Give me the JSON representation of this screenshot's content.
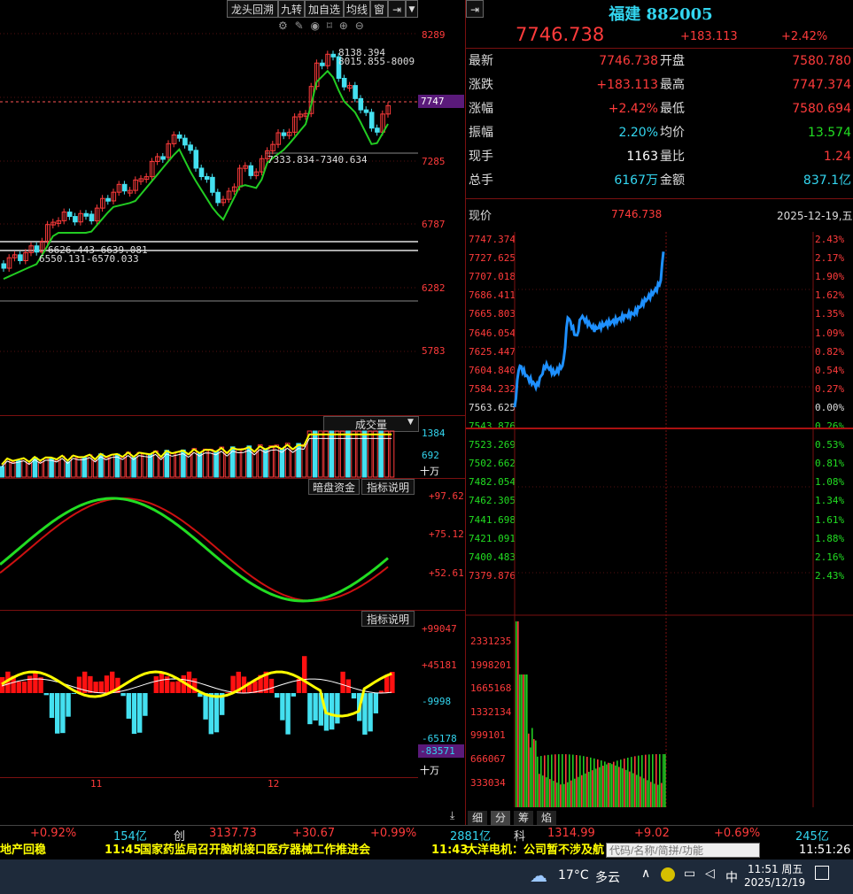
{
  "toolbar": {
    "buttons": [
      "龙头回溯",
      "九转",
      "加自选",
      "均线",
      "窗"
    ],
    "icon_names": [
      "settings-icon",
      "brush-icon",
      "eye-icon",
      "bookmark-icon",
      "zoom-in-icon",
      "zoom-out-icon"
    ]
  },
  "kline": {
    "price_axis": [
      "8289",
      "7747",
      "7285",
      "6787",
      "6282",
      "5783"
    ],
    "annotations": {
      "high": "8138.394",
      "high_range": "8015.855-8009",
      "mid_range": "7333.834-7340.634",
      "low_range_1": "6626.443-6639.081",
      "low_range_2": "6550.131-6570.033"
    },
    "current_price_tag": "7747"
  },
  "volume": {
    "panel_title": "成交量",
    "axis": [
      "1384",
      "692",
      "十万"
    ]
  },
  "kdj": {
    "buttons": [
      "暗盘资金",
      "指标说明"
    ],
    "axis": [
      "+97.62",
      "+75.12",
      "+52.61"
    ]
  },
  "macd": {
    "button": "指标说明",
    "axis": [
      "+99047",
      "+45181",
      "-9998",
      "-65178",
      "-83571",
      "十万"
    ],
    "months": [
      "11",
      "12"
    ]
  },
  "quote": {
    "name": "福建 882005",
    "price": "7746.738",
    "change": "+183.113",
    "change_pct": "+2.42%",
    "rows": [
      {
        "l1": "最新",
        "v1": "7746.738",
        "c1": "red",
        "l2": "开盘",
        "v2": "7580.780",
        "c2": "red"
      },
      {
        "l1": "涨跌",
        "v1": "+183.113",
        "c1": "red",
        "l2": "最高",
        "v2": "7747.374",
        "c2": "red"
      },
      {
        "l1": "涨幅",
        "v1": "+2.42%",
        "c1": "red",
        "l2": "最低",
        "v2": "7580.694",
        "c2": "red"
      },
      {
        "l1": "振幅",
        "v1": "2.20%",
        "c1": "cyan",
        "l2": "均价",
        "v2": "13.574",
        "c2": "green"
      },
      {
        "l1": "现手",
        "v1": "1163",
        "c1": "white",
        "l2": "量比",
        "v2": "1.24",
        "c2": "red"
      },
      {
        "l1": "总手",
        "v1": "6167万",
        "c1": "cyan",
        "l2": "金额",
        "v2": "837.1亿",
        "c2": "cyan"
      }
    ]
  },
  "intraday": {
    "header_label": "现价",
    "header_price": "7746.738",
    "header_date": "2025-12-19,五",
    "price_axis": [
      "7747.374",
      "7727.625",
      "7707.018",
      "7686.411",
      "7665.803",
      "7646.054",
      "7625.447",
      "7604.840",
      "7584.232",
      "7563.625",
      "7543.876",
      "7523.269",
      "7502.662",
      "7482.054",
      "7462.305",
      "7441.698",
      "7421.091",
      "7400.483",
      "7379.876"
    ],
    "pct_axis": [
      "2.43%",
      "2.17%",
      "1.90%",
      "1.62%",
      "1.35%",
      "1.09%",
      "0.82%",
      "0.54%",
      "0.27%",
      "0.00%",
      "0.26%",
      "0.53%",
      "0.81%",
      "1.08%",
      "1.34%",
      "1.61%",
      "1.88%",
      "2.16%",
      "2.43%"
    ],
    "volume_axis": [
      "2331235",
      "1998201",
      "1665168",
      "1332134",
      "999101",
      "666067",
      "333034"
    ],
    "tabs": [
      "细",
      "分",
      "筹",
      "焰"
    ]
  },
  "status_bar": {
    "items": [
      {
        "text": "+0.92%",
        "color": "red"
      },
      {
        "text": "154亿",
        "color": "cyan"
      },
      {
        "text": "创",
        "color": "white"
      },
      {
        "text": "3137.73",
        "color": "red"
      },
      {
        "text": "+30.67",
        "color": "red"
      },
      {
        "text": "+0.99%",
        "color": "red"
      },
      {
        "text": "2881亿",
        "color": "cyan"
      },
      {
        "text": "科",
        "color": "white"
      },
      {
        "text": "1314.99",
        "color": "red"
      },
      {
        "text": "+9.02",
        "color": "red"
      },
      {
        "text": "+0.69%",
        "color": "red"
      },
      {
        "text": "245亿",
        "color": "cyan"
      }
    ]
  },
  "news": {
    "left_cut": "地产回稳",
    "item1_time": "11:45",
    "item1_text": "国家药监局召开脑机接口医疗器械工作推进会",
    "item2_time": "11:43",
    "item2_text": "大洋电机：公司暂不涉及航",
    "search_placeholder": "代码/名称/简拼/功能",
    "clock": "11:51:26"
  },
  "taskbar": {
    "weather_temp": "17°C",
    "weather_desc": "多云",
    "ime": "中",
    "time": "11:51 周五",
    "date": "2025/12/19"
  },
  "colors": {
    "up": "#ff3b3b",
    "down": "#44e0f0",
    "ma": "#22cc22",
    "yellow": "#ffff00",
    "intraday_line": "#1e90ff"
  }
}
